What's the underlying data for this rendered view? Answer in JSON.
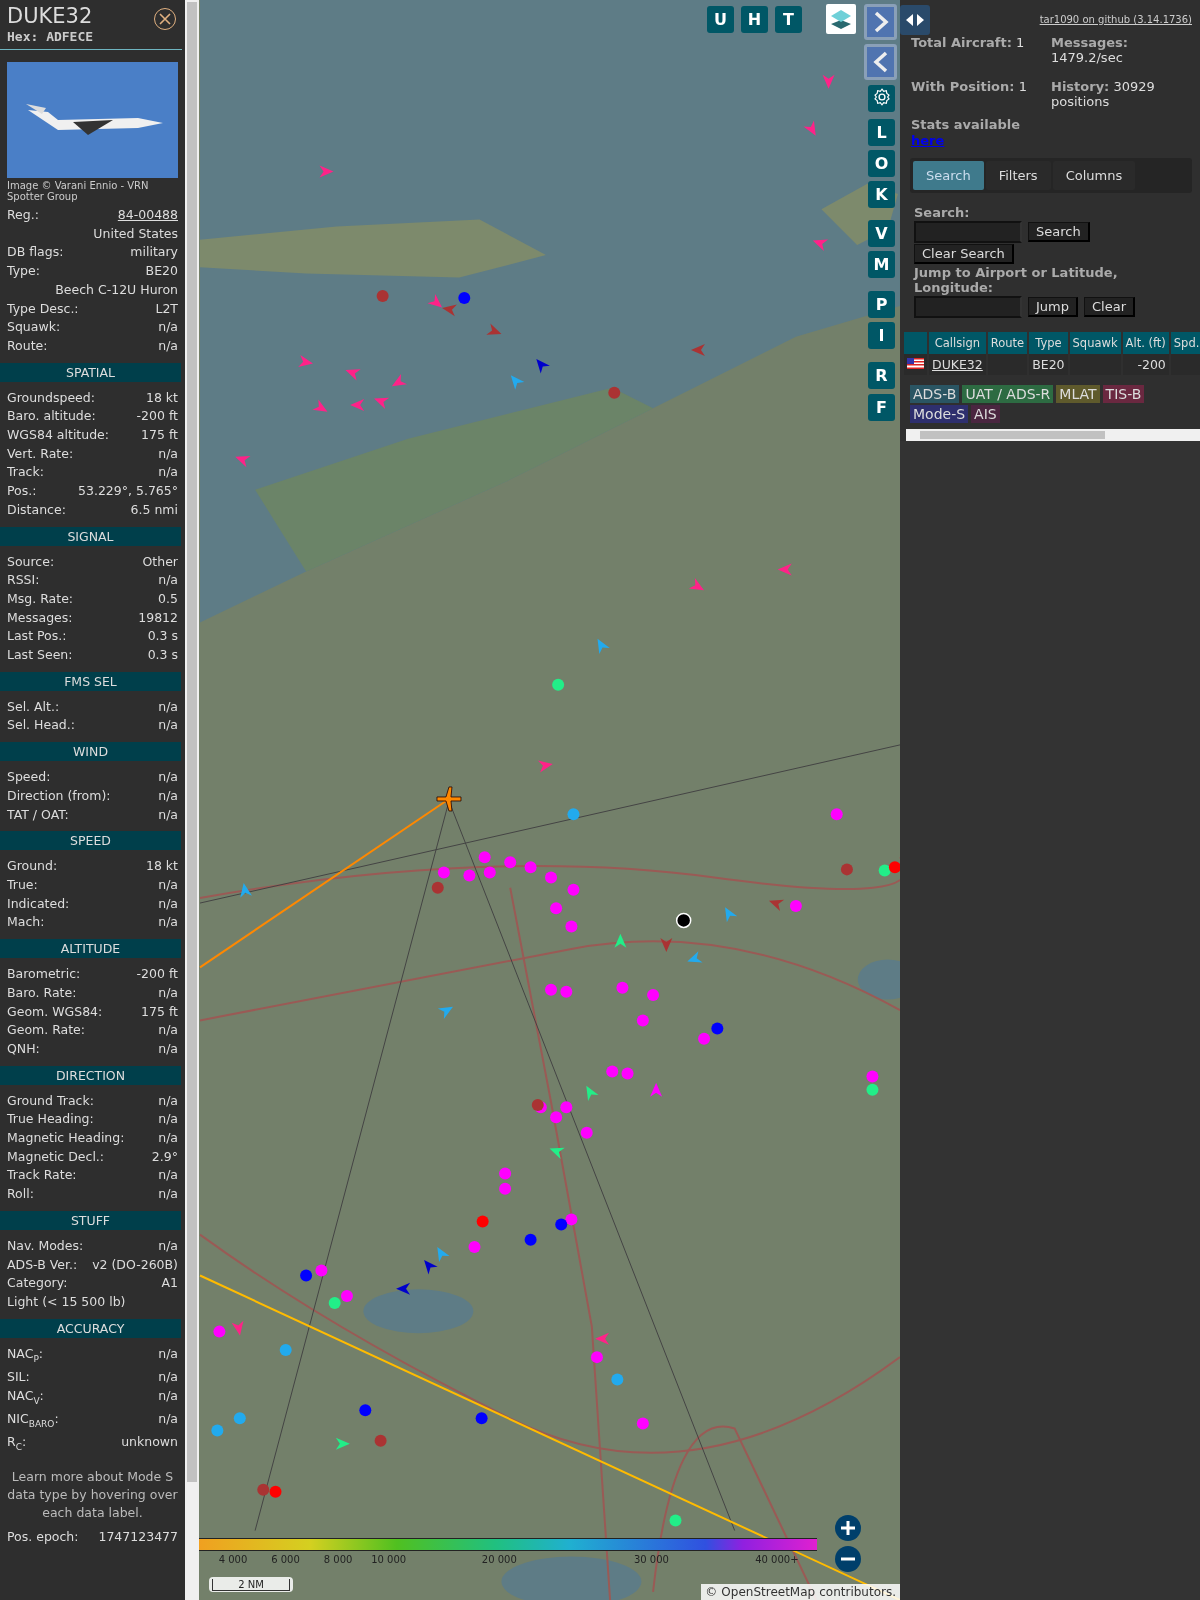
{
  "info": {
    "callsign": "DUKE32",
    "hex": "Hex: ADFECE",
    "photo_credit": "Image © Varani Ennio - VRN Spotter Group",
    "rows": [
      {
        "kind": "link",
        "label": "Reg.:",
        "value": "84-00488"
      },
      {
        "kind": "value",
        "value": "United States"
      },
      {
        "kind": "pair",
        "label": "DB flags:",
        "value": "military"
      },
      {
        "kind": "pair",
        "label": "Type:",
        "value": "BE20"
      },
      {
        "kind": "value",
        "value": "Beech C-12U Huron"
      },
      {
        "kind": "pair",
        "label": "Type Desc.:",
        "value": "L2T"
      },
      {
        "kind": "pair",
        "label": "Squawk:",
        "value": "n/a"
      },
      {
        "kind": "pair",
        "label": "Route:",
        "value": "n/a"
      }
    ],
    "sections": [
      {
        "title": "SPATIAL",
        "rows": [
          {
            "kind": "pair",
            "label": "Groundspeed:",
            "value": "18 kt"
          },
          {
            "kind": "pair",
            "label": "Baro. altitude:",
            "value": "-200 ft"
          },
          {
            "kind": "pair",
            "label": "WGS84 altitude:",
            "value": "175 ft"
          },
          {
            "kind": "pair",
            "label": "Vert. Rate:",
            "value": "n/a"
          },
          {
            "kind": "pair",
            "label": "Track:",
            "value": "n/a"
          },
          {
            "kind": "pair",
            "label": "Pos.:",
            "value": "53.229°, 5.765°"
          },
          {
            "kind": "pair",
            "label": "Distance:",
            "value": "6.5 nmi"
          }
        ]
      },
      {
        "title": "SIGNAL",
        "rows": [
          {
            "kind": "pair",
            "label": "Source:",
            "value": "Other"
          },
          {
            "kind": "pair",
            "label": "RSSI:",
            "value": "n/a"
          },
          {
            "kind": "pair",
            "label": "Msg. Rate:",
            "value": "0.5"
          },
          {
            "kind": "pair",
            "label": "Messages:",
            "value": "19812"
          },
          {
            "kind": "pair",
            "label": "Last Pos.:",
            "value": "0.3 s"
          },
          {
            "kind": "pair",
            "label": "Last Seen:",
            "value": "0.3 s"
          }
        ]
      },
      {
        "title": "FMS SEL",
        "rows": [
          {
            "kind": "pair",
            "label": "Sel. Alt.:",
            "value": "n/a"
          },
          {
            "kind": "pair",
            "label": "Sel. Head.:",
            "value": "n/a"
          }
        ]
      },
      {
        "title": "WIND",
        "rows": [
          {
            "kind": "pair",
            "label": "Speed:",
            "value": "n/a"
          },
          {
            "kind": "pair",
            "label": "Direction (from):",
            "value": "n/a"
          },
          {
            "kind": "pair",
            "label": "TAT / OAT:",
            "value": "n/a"
          }
        ]
      },
      {
        "title": "SPEED",
        "rows": [
          {
            "kind": "pair",
            "label": "Ground:",
            "value": "18 kt"
          },
          {
            "kind": "pair",
            "label": "True:",
            "value": "n/a"
          },
          {
            "kind": "pair",
            "label": "Indicated:",
            "value": "n/a"
          },
          {
            "kind": "pair",
            "label": "Mach:",
            "value": "n/a"
          }
        ]
      },
      {
        "title": "ALTITUDE",
        "rows": [
          {
            "kind": "pair",
            "label": "Barometric:",
            "value": "-200 ft"
          },
          {
            "kind": "pair",
            "label": "Baro. Rate:",
            "value": "n/a"
          },
          {
            "kind": "pair",
            "label": "Geom. WGS84:",
            "value": "175 ft"
          },
          {
            "kind": "pair",
            "label": "Geom. Rate:",
            "value": "n/a"
          },
          {
            "kind": "pair",
            "label": "QNH:",
            "value": "n/a"
          }
        ]
      },
      {
        "title": "DIRECTION",
        "rows": [
          {
            "kind": "pair",
            "label": "Ground Track:",
            "value": "n/a"
          },
          {
            "kind": "pair",
            "label": "True Heading:",
            "value": "n/a"
          },
          {
            "kind": "pair",
            "label": "Magnetic Heading:",
            "value": "n/a"
          },
          {
            "kind": "pair",
            "label": "Magnetic Decl.:",
            "value": "2.9°"
          },
          {
            "kind": "pair",
            "label": "Track Rate:",
            "value": "n/a"
          },
          {
            "kind": "pair",
            "label": "Roll:",
            "value": "n/a"
          }
        ]
      },
      {
        "title": "STUFF",
        "rows": [
          {
            "kind": "pair",
            "label": "Nav. Modes:",
            "value": "n/a"
          },
          {
            "kind": "pair",
            "label": "ADS-B Ver.:",
            "value": "v2 (DO-260B)"
          },
          {
            "kind": "pair",
            "label": "Category:",
            "value": "A1"
          },
          {
            "kind": "text",
            "value": "Light (< 15 500 lb)"
          }
        ]
      },
      {
        "title": "ACCURACY",
        "rows": [
          {
            "kind": "pair",
            "label": "NAC$_{P}$:",
            "value": "n/a"
          },
          {
            "kind": "pair",
            "label": "SIL:",
            "value": "n/a"
          },
          {
            "kind": "pair",
            "label": "NAC$_{V}$:",
            "value": "n/a"
          },
          {
            "kind": "pair",
            "label": "NIC$_{BARO}$:",
            "value": "n/a"
          },
          {
            "kind": "pair",
            "label": "R$_{C}$:",
            "value": "unknown"
          }
        ]
      }
    ],
    "note": "Learn more about Mode S data type by hovering over each data label.",
    "epoch": {
      "label": "Pos. epoch:",
      "value": "1747123477"
    }
  },
  "map": {
    "top_buttons": [
      "U",
      "H",
      "T"
    ],
    "side_buttons": [
      "L",
      "O",
      "K",
      "V",
      "M",
      "P",
      "I",
      "R",
      "F"
    ],
    "altitude_ticks": [
      "4 000",
      "6 000",
      "8 000",
      "10 000",
      "20 000",
      "30 000",
      "40 000+"
    ],
    "scale": "2 NM",
    "attribution_prefix": "©",
    "attribution_link": "OpenStreetMap",
    "attribution_suffix": "contributors."
  },
  "sidebar": {
    "github_link": "tar1090 on github (3.14.1736)",
    "stats": [
      {
        "label": "Total Aircraft:",
        "value": "1"
      },
      {
        "label": "Messages:",
        "value": "1479.2/sec"
      },
      {
        "label": "With Position:",
        "value": "1"
      },
      {
        "label": "History:",
        "value": "30929 positions"
      }
    ],
    "stats_note": "Stats available",
    "stats_link": "here",
    "tabs": [
      {
        "label": "Search",
        "selected": true
      },
      {
        "label": "Filters",
        "selected": false
      },
      {
        "label": "Columns",
        "selected": false
      }
    ],
    "search_label": "Search:",
    "search_button": "Search",
    "clear_search_button": "Clear Search",
    "jump_label": "Jump to Airport or Latitude, Longitude:",
    "jump_button": "Jump",
    "clear_button": "Clear",
    "table": {
      "columns": [
        "Callsign",
        "Route",
        "Type",
        "Squawk",
        "Alt. (ft)",
        "Spd."
      ],
      "rows": [
        {
          "cells": [
            "DUKE32",
            null,
            "BE20",
            null,
            "-200",
            null
          ]
        }
      ]
    },
    "legend": [
      {
        "label": "ADS-B",
        "color": "#2a5563"
      },
      {
        "label": "UAT / ADS-R",
        "color": "#2d6b42"
      },
      {
        "label": "MLAT",
        "color": "#5f5a2c"
      },
      {
        "label": "TIS-B",
        "color": "#6a2840"
      },
      {
        "label": "Mode-S",
        "color": "#2e2f6e"
      },
      {
        "label": "AIS",
        "color": "#4a2640"
      }
    ]
  }
}
